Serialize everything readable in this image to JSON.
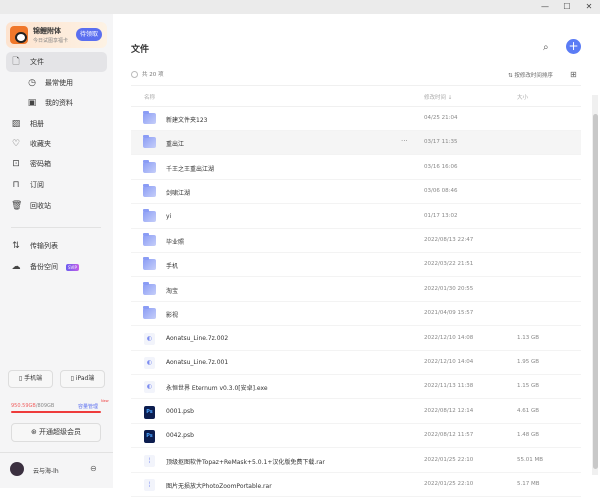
{
  "window": {
    "minimize": "—",
    "maximize": "☐",
    "close": "✕"
  },
  "promo": {
    "title": "锦鲤附体",
    "subtitle": "今日试图享福卡",
    "button": "待领取"
  },
  "sidebar": {
    "items": [
      {
        "label": "文件",
        "icon": "file-icon"
      },
      {
        "label": "最常使用",
        "icon": "clock-icon"
      },
      {
        "label": "我的资料",
        "icon": "document-icon"
      },
      {
        "label": "相册",
        "icon": "photo-icon"
      },
      {
        "label": "收藏夹",
        "icon": "heart-icon"
      },
      {
        "label": "密码箱",
        "icon": "safe-icon"
      },
      {
        "label": "订阅",
        "icon": "bookmark-icon"
      },
      {
        "label": "回收站",
        "icon": "trash-icon"
      },
      {
        "label": "传输列表",
        "icon": "transfer-icon"
      },
      {
        "label": "备份空间",
        "icon": "cloud-icon",
        "badge": "SVIP"
      }
    ],
    "phone_button": "手机端",
    "ipad_button": "iPad端",
    "storage_used": "950.59GB",
    "storage_total": "/809GB",
    "storage_manage": "容量管理",
    "new_badge": "New",
    "storage_percent": 100,
    "vip_button": "开通超级会员",
    "username": "云与海-lh"
  },
  "main": {
    "title": "文件",
    "count": "共 20 项",
    "sort": "按修改时间排序",
    "columns": {
      "name": "名称",
      "modified": "修改时间 ↓",
      "size": "大小"
    },
    "rows": [
      {
        "name": "新建文件夹123",
        "date": "04/25 21:04",
        "size": "",
        "type": "folder"
      },
      {
        "name": "重出江",
        "date": "03/17 11:35",
        "size": "",
        "type": "folder"
      },
      {
        "name": "千王之王重出江湖",
        "date": "03/16 16:06",
        "size": "",
        "type": "folder"
      },
      {
        "name": "剑啸江湖",
        "date": "03/06 08:46",
        "size": "",
        "type": "folder"
      },
      {
        "name": "yi",
        "date": "01/17 13:02",
        "size": "",
        "type": "folder"
      },
      {
        "name": "毕业照",
        "date": "2022/08/13 22:47",
        "size": "",
        "type": "folder"
      },
      {
        "name": "手机",
        "date": "2022/03/22 21:51",
        "size": "",
        "type": "folder"
      },
      {
        "name": "淘宝",
        "date": "2022/01/30 20:55",
        "size": "",
        "type": "folder"
      },
      {
        "name": "影视",
        "date": "2021/04/09 15:57",
        "size": "",
        "type": "folder"
      },
      {
        "name": "Aonatsu_Line.7z.002",
        "date": "2022/12/10 14:08",
        "size": "1.13 GB",
        "type": "archive"
      },
      {
        "name": "Aonatsu_Line.7z.001",
        "date": "2022/12/10 14:04",
        "size": "1.95 GB",
        "type": "archive"
      },
      {
        "name": "永恒世界 Eternum v0.3.0[安卓].exe",
        "date": "2022/11/13 11:38",
        "size": "1.15 GB",
        "type": "archive"
      },
      {
        "name": "0001.psb",
        "date": "2022/08/12 12:14",
        "size": "4.61 GB",
        "type": "ps"
      },
      {
        "name": "0042.psb",
        "date": "2022/08/12 11:57",
        "size": "1.48 GB",
        "type": "ps"
      },
      {
        "name": "顶级抠图软件Topaz+ReMask+5.0.1+汉化版免费下载.rar",
        "date": "2022/01/25 22:10",
        "size": "55.01 MB",
        "type": "rar"
      },
      {
        "name": "图片无损放大PhotoZoomPortable.rar",
        "date": "2022/01/25 22:10",
        "size": "5.17 MB",
        "type": "rar"
      }
    ],
    "more": "···",
    "ps_label": "Ps"
  }
}
